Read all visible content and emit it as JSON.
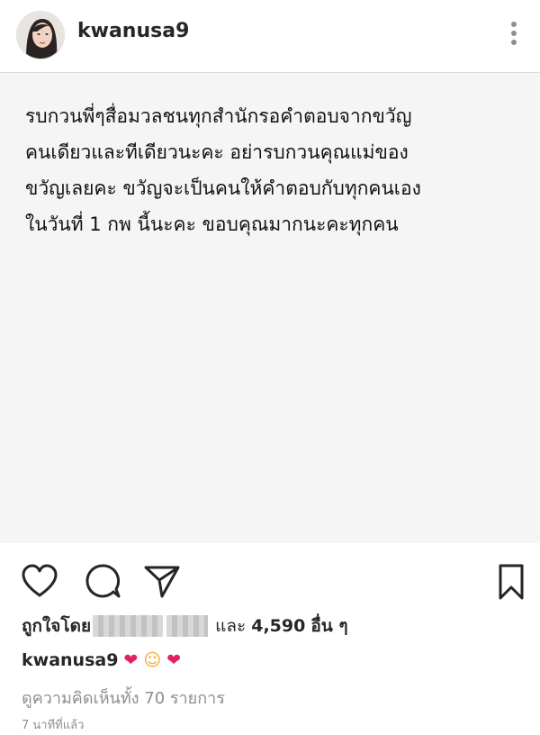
{
  "header": {
    "username": "kwanusa9",
    "avatar_icon": "user-avatar",
    "more_icon": "more-vertical-icon"
  },
  "post": {
    "text": "รบกวนพี่ๆสื่อมวลชนทุกสำนักรอคำตอบจากขวัญ\nคนเดียวและทีเดียวนะคะ อย่ารบกวนคุณแม่ของ\nขวัญเลยคะ ขวัญจะเป็นคนให้คำตอบกับทุกคนเอง\nในวันที่ 1 กพ นี้นะคะ ขอบคุณมากนะคะทุกคน"
  },
  "actions": {
    "like_icon": "heart-icon",
    "comment_icon": "comment-icon",
    "share_icon": "send-icon",
    "save_icon": "bookmark-icon"
  },
  "likes": {
    "prefix": "ถูกใจโดย",
    "middle": "และ",
    "count": "4,590",
    "suffix": "อื่น ๆ"
  },
  "caption": {
    "username": "kwanusa9",
    "emojis": [
      "❤",
      "☺",
      "❤"
    ]
  },
  "comments": {
    "label": "ดูความคิดเห็นทั้ง 70 รายการ"
  },
  "time": {
    "label": "7 นาทีที่แล้ว"
  },
  "colors": {
    "heart": "#e0245e",
    "muted": "#8e8e8e",
    "post_bg": "#f5f5f5"
  }
}
